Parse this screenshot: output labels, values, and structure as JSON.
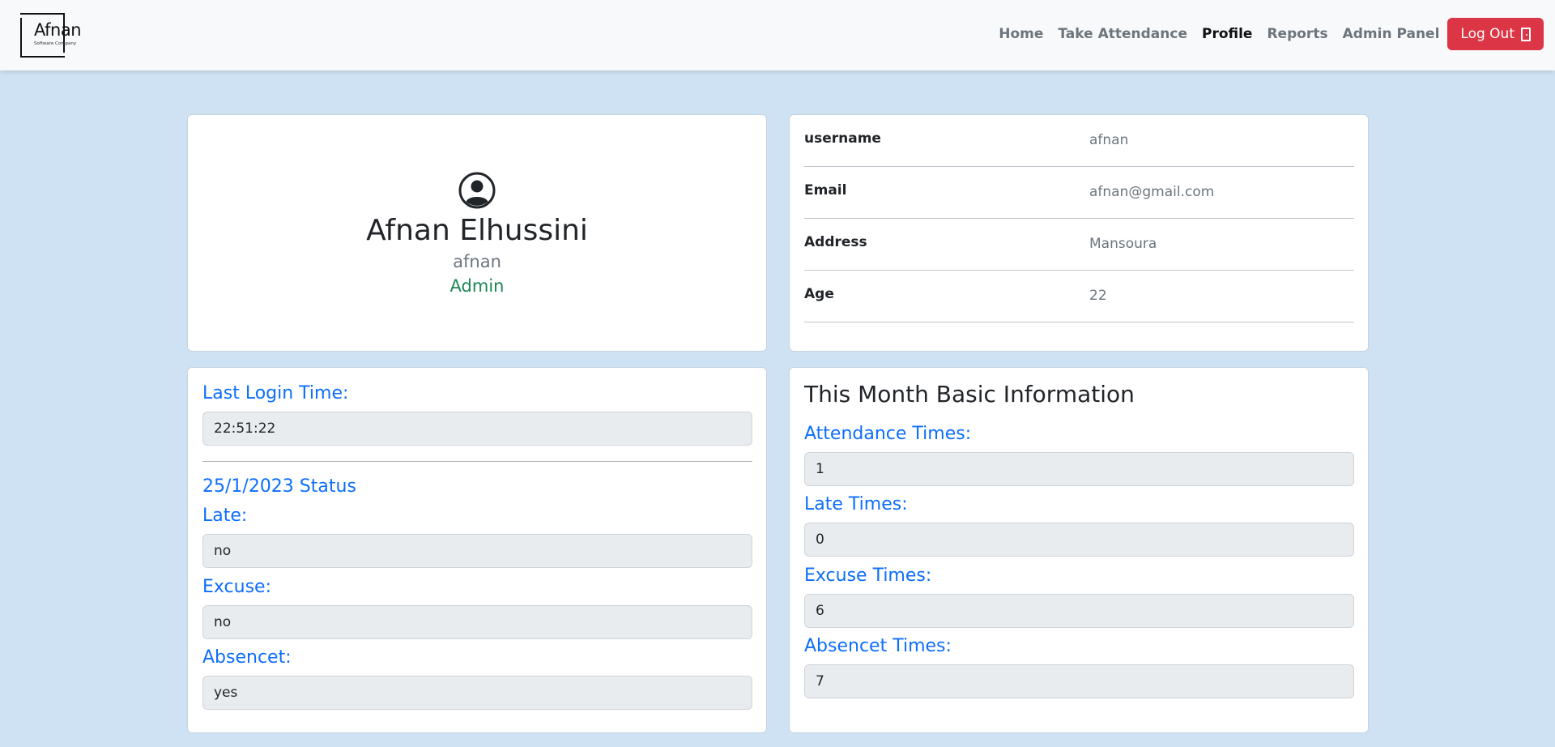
{
  "brand": {
    "name": "Afnan",
    "tagline": "Software Company"
  },
  "nav": {
    "links": [
      "Home",
      "Take Attendance",
      "Profile",
      "Reports",
      "Admin Panel"
    ],
    "active": "Profile",
    "logout_label": "Log Out"
  },
  "profile": {
    "full_name": "Afnan Elhussini",
    "username": "afnan",
    "role": "Admin"
  },
  "details": [
    {
      "label": "username",
      "value": "afnan"
    },
    {
      "label": "Email",
      "value": "afnan@gmail.com"
    },
    {
      "label": "Address",
      "value": "Mansoura"
    },
    {
      "label": "Age",
      "value": "22"
    }
  ],
  "login": {
    "last_login_label": "Last Login Time:",
    "last_login_value": "22:51:22",
    "status_title": "25/1/2023 Status",
    "late_label": "Late:",
    "late_value": "no",
    "excuse_label": "Excuse:",
    "excuse_value": "no",
    "absence_label": "Absencet:",
    "absence_value": "yes"
  },
  "month": {
    "title": "This Month Basic Information",
    "attendance_label": "Attendance Times:",
    "attendance_value": "1",
    "late_label": "Late Times:",
    "late_value": "0",
    "excuse_label": "Excuse Times:",
    "excuse_value": "6",
    "absence_label": "Absencet Times:",
    "absence_value": "7"
  },
  "colors": {
    "background": "#cfe2f3",
    "accent_blue": "#0d6efd",
    "admin_green": "#198754",
    "logout_red": "#dc3545"
  }
}
